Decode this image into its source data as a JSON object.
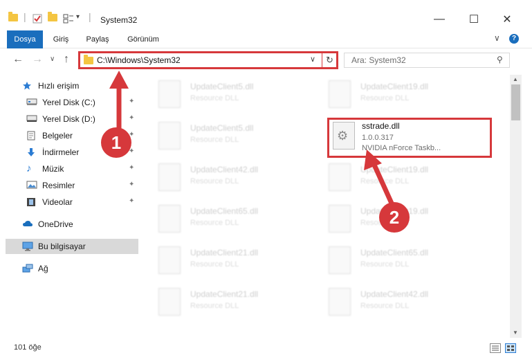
{
  "window": {
    "title": "System32",
    "minimize_glyph": "—",
    "maximize_glyph": "☐",
    "close_glyph": "✕"
  },
  "quick_access_toolbar": {
    "separator": "|",
    "dropdown_glyph": "▾"
  },
  "ribbon": {
    "tabs": [
      {
        "label": "Dosya",
        "active": true
      },
      {
        "label": "Giriş"
      },
      {
        "label": "Paylaş"
      },
      {
        "label": "Görünüm"
      }
    ],
    "help_label": "?",
    "collapse_glyph": "∨"
  },
  "navigation": {
    "back_glyph": "←",
    "forward_glyph": "→",
    "recent_glyph": "∨",
    "up_glyph": "↑"
  },
  "address_bar": {
    "path": "C:\\Windows\\System32",
    "dropdown_glyph": "∨",
    "refresh_glyph": "↻"
  },
  "search": {
    "placeholder": "Ara: System32",
    "icon": "search-icon",
    "icon_glyph": "⚲"
  },
  "sidebar": {
    "pin_glyph": "✦",
    "items": [
      {
        "label": "Hızlı erişim",
        "icon": "star-icon"
      },
      {
        "label": "Yerel Disk (C:)",
        "icon": "drive-icon",
        "pinned": true
      },
      {
        "label": "Yerel Disk (D:)",
        "icon": "drive-icon",
        "pinned": true
      },
      {
        "label": "Belgeler",
        "icon": "documents-icon",
        "pinned": true
      },
      {
        "label": "İndirmeler",
        "icon": "download-icon",
        "pinned": true
      },
      {
        "label": "Müzik",
        "icon": "music-icon",
        "pinned": true
      },
      {
        "label": "Resimler",
        "icon": "pictures-icon",
        "pinned": true
      },
      {
        "label": "Videolar",
        "icon": "videos-icon",
        "pinned": true
      },
      {
        "label": "OneDrive",
        "icon": "cloud-icon"
      },
      {
        "label": "Bu bilgisayar",
        "icon": "computer-icon",
        "selected": true
      },
      {
        "label": "Ağ",
        "icon": "network-icon"
      }
    ]
  },
  "files": {
    "blurred": [
      {
        "name": "UpdateClient5.dll",
        "desc": "Resource DLL"
      },
      {
        "name": "UpdateClient19.dll",
        "desc": "Resource DLL"
      },
      {
        "name": "UpdateClient5.dll",
        "desc": "Resource DLL"
      },
      {
        "name": "UpdateClient42.dll",
        "desc": "Resource DLL"
      },
      {
        "name": "UpdateClient19.dll",
        "desc": "Resource DLL"
      },
      {
        "name": "UpdateClient65.dll",
        "desc": "Resource DLL"
      },
      {
        "name": "UpdateClient19.dll",
        "desc": "Resource DLL"
      },
      {
        "name": "UpdateClient21.dll",
        "desc": "Resource DLL"
      },
      {
        "name": "UpdateClient65.dll",
        "desc": "Resource DLL"
      },
      {
        "name": "UpdateClient21.dll",
        "desc": "Resource DLL"
      },
      {
        "name": "UpdateClient42.dll",
        "desc": "Resource DLL"
      }
    ],
    "highlighted": {
      "name": "sstrade.dll",
      "version": "1.0.0.317",
      "description": "NVIDIA nForce Taskb...",
      "icon": "gear-icon",
      "icon_glyph": "⚙"
    }
  },
  "scrollbar": {
    "up_glyph": "▲",
    "down_glyph": "▼"
  },
  "status_bar": {
    "item_count": "101 öğe"
  },
  "annotations": {
    "step1": "1",
    "step2": "2"
  },
  "colors": {
    "accent": "#1a6ebd",
    "highlight_red": "#d6383b",
    "folder_yellow": "#f4c542",
    "selected_bg": "#d9d9d9"
  }
}
